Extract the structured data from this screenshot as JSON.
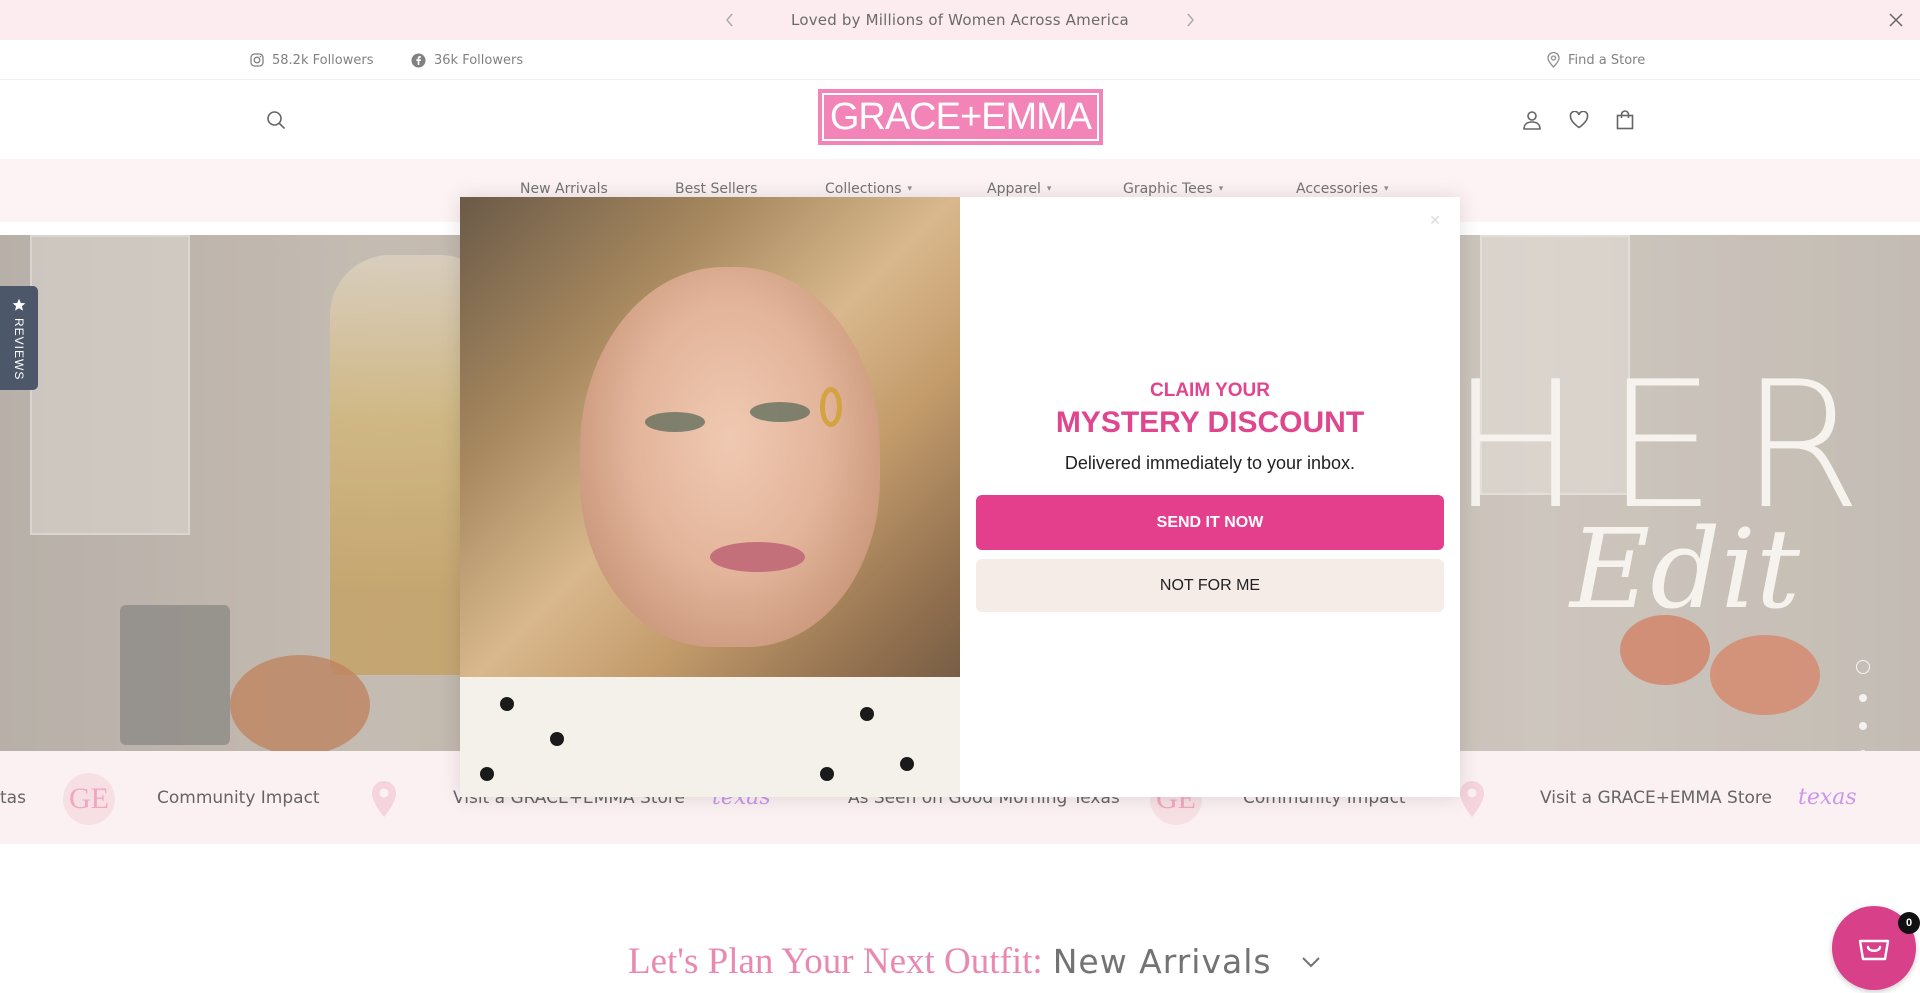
{
  "announcement": {
    "message": "Loved by Millions of Women Across America",
    "prev_icon": "chevron-left-icon",
    "next_icon": "chevron-right-icon",
    "close_icon": "close-icon"
  },
  "social": {
    "instagram": "58.2k Followers",
    "facebook": "36k Followers",
    "find_store": "Find a Store"
  },
  "header": {
    "logo_text": "GRACE+EMMA",
    "icons": [
      "search-icon",
      "account-icon",
      "wishlist-icon",
      "bag-icon"
    ]
  },
  "nav": {
    "items": [
      {
        "label": "New Arrivals",
        "dropdown": false
      },
      {
        "label": "Best Sellers",
        "dropdown": false
      },
      {
        "label": "Collections",
        "dropdown": true
      },
      {
        "label": "Apparel",
        "dropdown": true
      },
      {
        "label": "Graphic Tees",
        "dropdown": true
      },
      {
        "label": "Accessories",
        "dropdown": true
      }
    ]
  },
  "hero": {
    "headline_fragment": "HER",
    "script_text": "Edit",
    "slide_count": 5,
    "active_slide": 1
  },
  "reviews_tab": {
    "label": "REVIEWS"
  },
  "marquee": {
    "items": [
      "tas",
      "Community Impact",
      "Visit a GRACE+EMMA Store",
      "As Seen on Good Morning Texas",
      "Community Impact",
      "Visit a GRACE+EMMA Store"
    ],
    "ge_mark": "GE",
    "gmt_mark": "texas"
  },
  "popup": {
    "kicker": "CLAIM YOUR",
    "title": "MYSTERY DISCOUNT",
    "subtitle": "Delivered immediately to your inbox.",
    "primary_button": "SEND IT NOW",
    "secondary_button": "NOT FOR ME",
    "close_icon": "close-icon"
  },
  "section": {
    "prefix": "Let's Plan Your Next Outfit:",
    "selected": "New Arrivals"
  },
  "cart": {
    "count": "0"
  },
  "colors": {
    "brand_pink": "#e43f8d",
    "logo_pink": "#f06aa8",
    "announce_bg": "#fce8ec",
    "nav_bg": "#fdf1f2",
    "reviews_bg": "#27324a"
  }
}
